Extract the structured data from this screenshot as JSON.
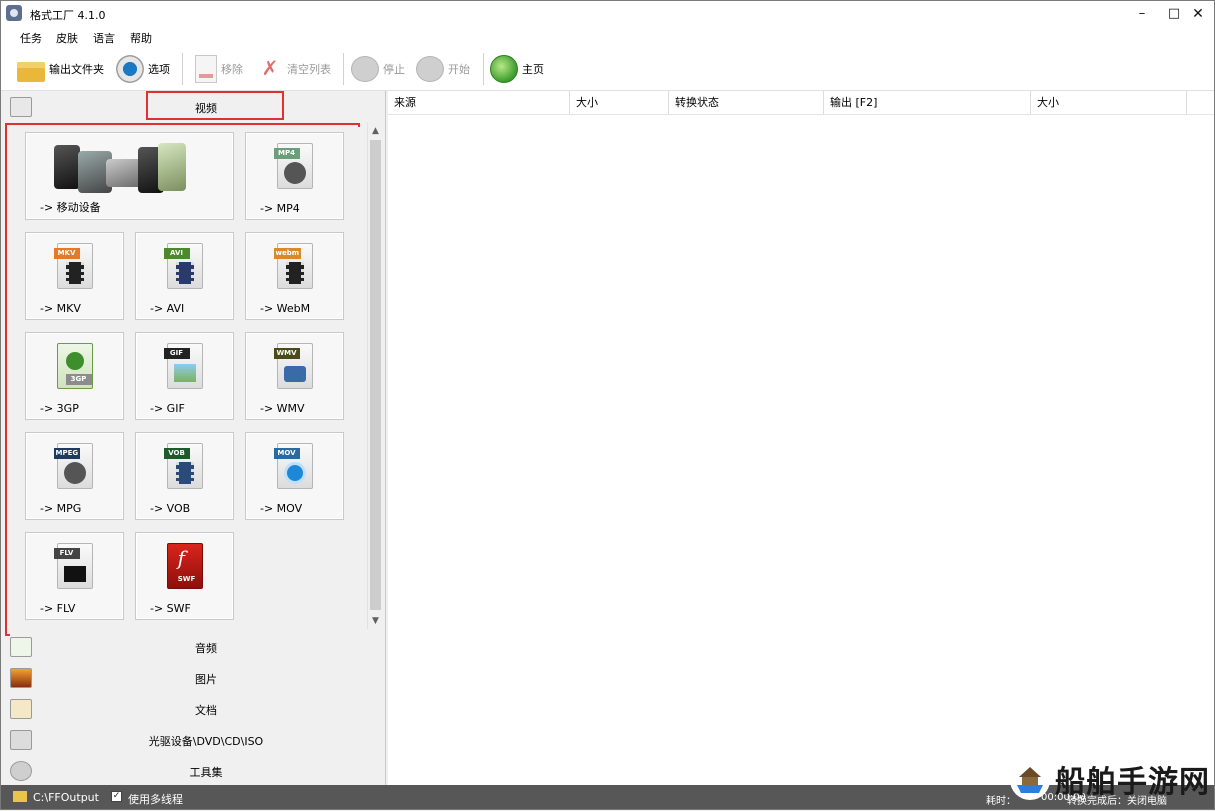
{
  "window": {
    "title": "格式工厂 4.1.0"
  },
  "menu": [
    "任务",
    "皮肤",
    "语言",
    "帮助"
  ],
  "toolbar": {
    "output_folder": "输出文件夹",
    "options": "选项",
    "remove": "移除",
    "clear_list": "清空列表",
    "stop": "停止",
    "start": "开始",
    "home": "主页"
  },
  "left": {
    "video_label": "视频",
    "tiles": [
      "-> 移动设备",
      "-> MP4",
      "-> MKV",
      "-> AVI",
      "-> WebM",
      "-> 3GP",
      "-> GIF",
      "-> WMV",
      "-> MPG",
      "-> VOB",
      "-> MOV",
      "-> FLV",
      "-> SWF"
    ],
    "tags": {
      "mp4": "MP4",
      "mkv": "MKV",
      "avi": "AVI",
      "webm": "webm",
      "gp3": "3GP",
      "gif": "GIF",
      "wmv": "WMV",
      "mpeg": "MPEG",
      "vob": "VOB",
      "mov": "MOV",
      "flv": "FLV",
      "swf": "SWF"
    },
    "categories": [
      "音频",
      "图片",
      "文档",
      "光驱设备\\DVD\\CD\\ISO",
      "工具集"
    ]
  },
  "table": {
    "columns": [
      "来源",
      "大小",
      "转换状态",
      "输出 [F2]",
      "大小"
    ]
  },
  "status": {
    "output_path": "C:\\FFOutput",
    "multithread": "使用多线程",
    "elapsed": "耗时：",
    "time": "00:00:00",
    "after": "转换完成后：关闭电脑"
  },
  "watermark": "船舶手游网",
  "colors": {
    "highlight": "#e03131",
    "statusbar": "#575757"
  }
}
